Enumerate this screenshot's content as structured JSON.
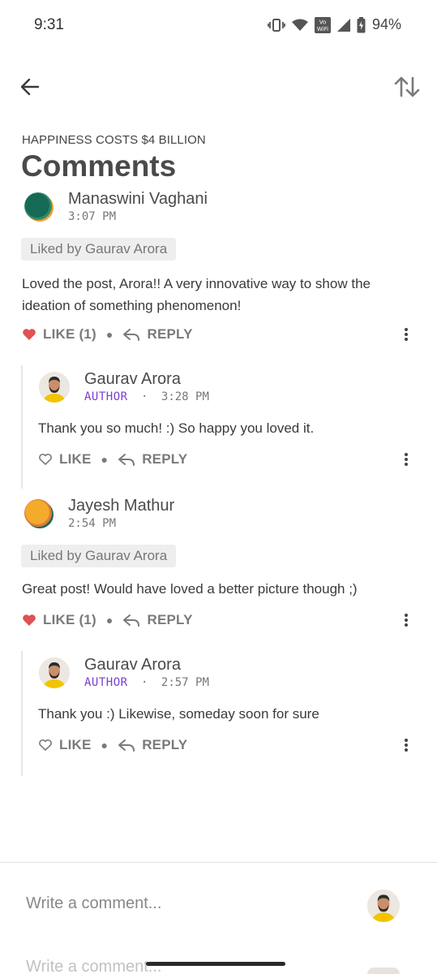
{
  "status_bar": {
    "time": "9:31",
    "battery": "94%",
    "icons": [
      "vibrate-icon",
      "wifi-icon",
      "vowifi-icon",
      "signal-icon",
      "battery-icon"
    ],
    "vowifi_label_top": "Vo",
    "vowifi_label_bottom": "WiFi"
  },
  "top_bar": {
    "back_icon": "arrow-left-icon",
    "sort_icon": "sort-icon"
  },
  "post": {
    "subtitle": "HAPPINESS COSTS $4 BILLION",
    "title": "Comments"
  },
  "colors": {
    "heart": "#e05252",
    "author": "#7b3fd0",
    "badge_bg": "#eeeeee"
  },
  "comments": [
    {
      "name": "Manaswini Vaghani",
      "time": "3:07 PM",
      "liked_by": "Liked by Gaurav Arora",
      "text_line1": "Loved the post, Arora!! A very innovative way to show the",
      "text_line2": "ideation of something phenomenon!",
      "like_label": "LIKE (1)",
      "reply_label": "REPLY",
      "liked": true,
      "reply": {
        "name": "Gaurav Arora",
        "role": "AUTHOR",
        "separator": "·",
        "time": "3:28 PM",
        "text": "Thank you so much! :) So happy you loved it.",
        "like_label": "LIKE",
        "reply_label": "REPLY"
      }
    },
    {
      "name": "Jayesh Mathur",
      "time": "2:54 PM",
      "liked_by": "Liked by Gaurav Arora",
      "text_line1": "Great post! Would have loved a better picture though ;)",
      "like_label": "LIKE (1)",
      "reply_label": "REPLY",
      "liked": true,
      "reply": {
        "name": "Gaurav Arora",
        "role": "AUTHOR",
        "separator": "·",
        "time": "2:57 PM",
        "text": "Thank you :) Likewise, someday soon for sure",
        "like_label": "LIKE",
        "reply_label": "REPLY"
      }
    }
  ],
  "composer": {
    "placeholder": "Write a comment...",
    "ghost_text": "Write a comment..."
  }
}
